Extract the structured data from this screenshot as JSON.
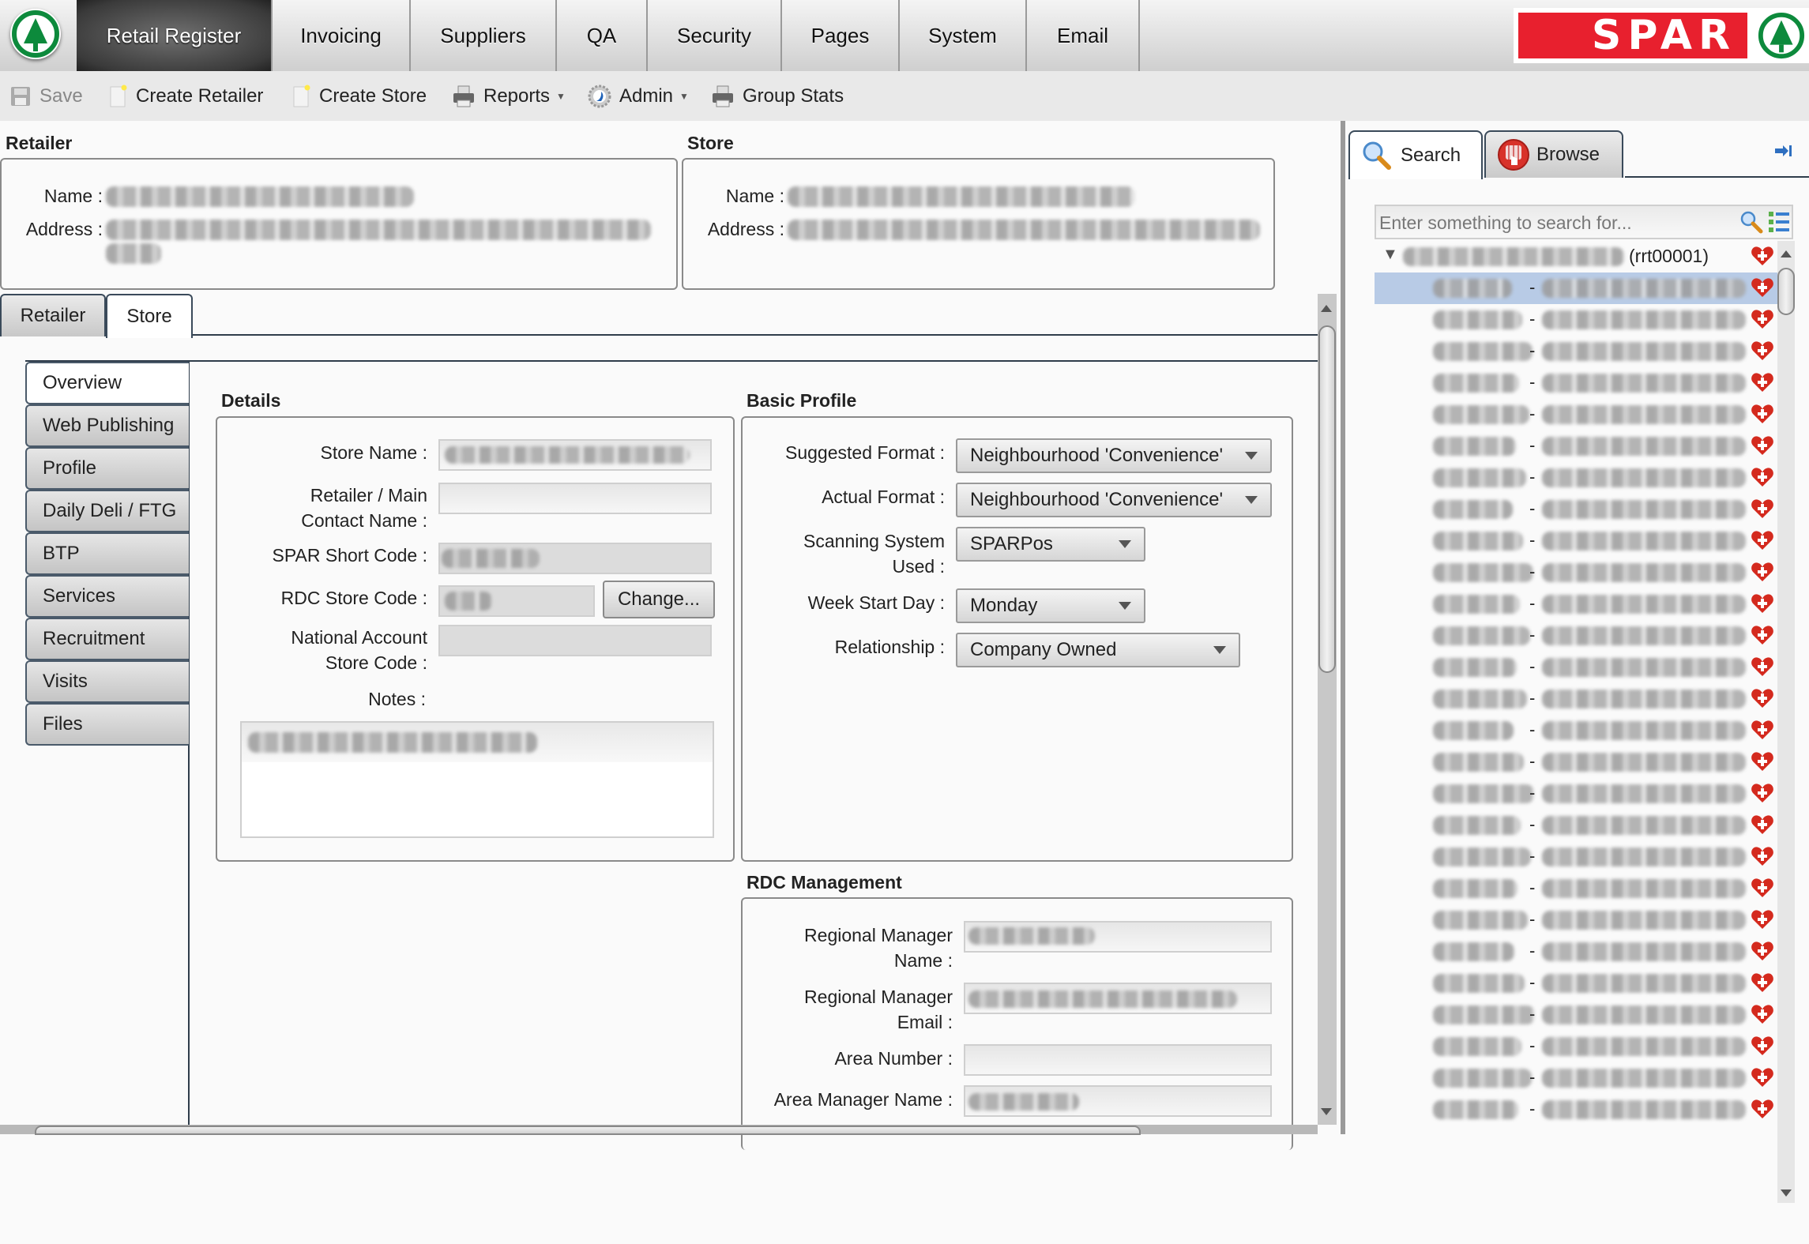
{
  "nav": {
    "tabs": [
      {
        "label": "Retail Register",
        "active": true
      },
      {
        "label": "Invoicing"
      },
      {
        "label": "Suppliers"
      },
      {
        "label": "QA"
      },
      {
        "label": "Security"
      },
      {
        "label": "Pages"
      },
      {
        "label": "System"
      },
      {
        "label": "Email"
      }
    ],
    "brand": "SPAR",
    "brand_color": "#e8202e",
    "logo_green": "#0d8a3c"
  },
  "toolbar": {
    "save": "Save",
    "create_retailer": "Create Retailer",
    "create_store": "Create Store",
    "reports": "Reports",
    "admin": "Admin",
    "group_stats": "Group Stats"
  },
  "retailer_header": {
    "title": "Retailer",
    "name_label": "Name :",
    "address_label": "Address :",
    "name_value": "[redacted]",
    "address_value": "[redacted]"
  },
  "store_header": {
    "title": "Store",
    "name_label": "Name :",
    "address_label": "Address :",
    "name_value": "[redacted]",
    "address_value": "[redacted]"
  },
  "entity_tabs": [
    {
      "label": "Retailer"
    },
    {
      "label": "Store",
      "active": true
    }
  ],
  "side_tabs": [
    {
      "label": "Overview",
      "active": true
    },
    {
      "label": "Web Publishing"
    },
    {
      "label": "Profile"
    },
    {
      "label": "Daily Deli / FTG"
    },
    {
      "label": "BTP"
    },
    {
      "label": "Services"
    },
    {
      "label": "Recruitment"
    },
    {
      "label": "Visits"
    },
    {
      "label": "Files"
    }
  ],
  "details": {
    "title": "Details",
    "store_name_label": "Store Name :",
    "store_name_value": "[redacted]",
    "contact_label_1": "Retailer / Main",
    "contact_label_2": "Contact Name :",
    "contact_value": "",
    "short_code_label": "SPAR Short Code :",
    "short_code_value": "[redacted]",
    "rdc_code_label": "RDC Store Code :",
    "rdc_code_value": "[redacted]",
    "change_button": "Change...",
    "national_label_1": "National Account",
    "national_label_2": "Store Code :",
    "national_value": "",
    "notes_label": "Notes :",
    "notes_value": "[redacted]"
  },
  "basic_profile": {
    "title": "Basic Profile",
    "suggested_format_label": "Suggested Format :",
    "suggested_format_value": "Neighbourhood 'Convenience'",
    "actual_format_label": "Actual Format :",
    "actual_format_value": "Neighbourhood 'Convenience'",
    "scanning_label_1": "Scanning System",
    "scanning_label_2": "Used :",
    "scanning_value": "SPARPos",
    "week_start_label": "Week Start Day :",
    "week_start_value": "Monday",
    "relationship_label": "Relationship :",
    "relationship_value": "Company Owned"
  },
  "rdc_management": {
    "title": "RDC Management",
    "rm_name_label_1": "Regional Manager",
    "rm_name_label_2": "Name :",
    "rm_name_value": "[redacted]",
    "rm_email_label_1": "Regional Manager",
    "rm_email_label_2": "Email :",
    "rm_email_value": "[redacted]",
    "area_number_label": "Area Number :",
    "area_number_value": "",
    "area_manager_label": "Area Manager Name :",
    "area_manager_value": "[redacted]"
  },
  "right_panel": {
    "search_tab": "Search",
    "browse_tab": "Browse",
    "search_placeholder": "Enter something to search for...",
    "tree_root_suffix": "(rrt00001)",
    "tree_child_count": 27,
    "selected_index": 0
  }
}
